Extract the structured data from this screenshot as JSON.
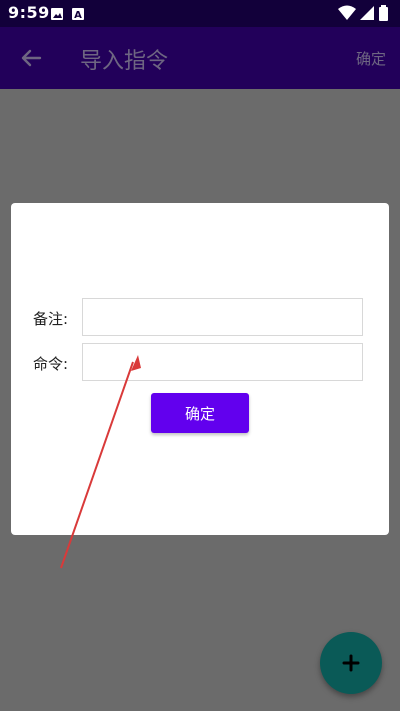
{
  "status_bar": {
    "time": "9:59",
    "left_icons": [
      "image-icon",
      "text-a-icon"
    ],
    "right_icons": [
      "wifi-icon",
      "signal-icon",
      "battery-icon"
    ]
  },
  "toolbar": {
    "title": "导入指令",
    "action_label": "确定",
    "back_icon": "arrow-left-icon"
  },
  "dialog": {
    "remark_label": "备注:",
    "remark_value": "",
    "command_label": "命令:",
    "command_value": "",
    "confirm_label": "确定"
  },
  "fab": {
    "icon": "plus-icon"
  },
  "colors": {
    "status_bar": "#12003a",
    "toolbar": "#22005a",
    "overlay": "#6b6b6b",
    "primary_button": "#6200ee",
    "fab": "#0a5a57",
    "annotation_arrow": "#d93a3a"
  }
}
